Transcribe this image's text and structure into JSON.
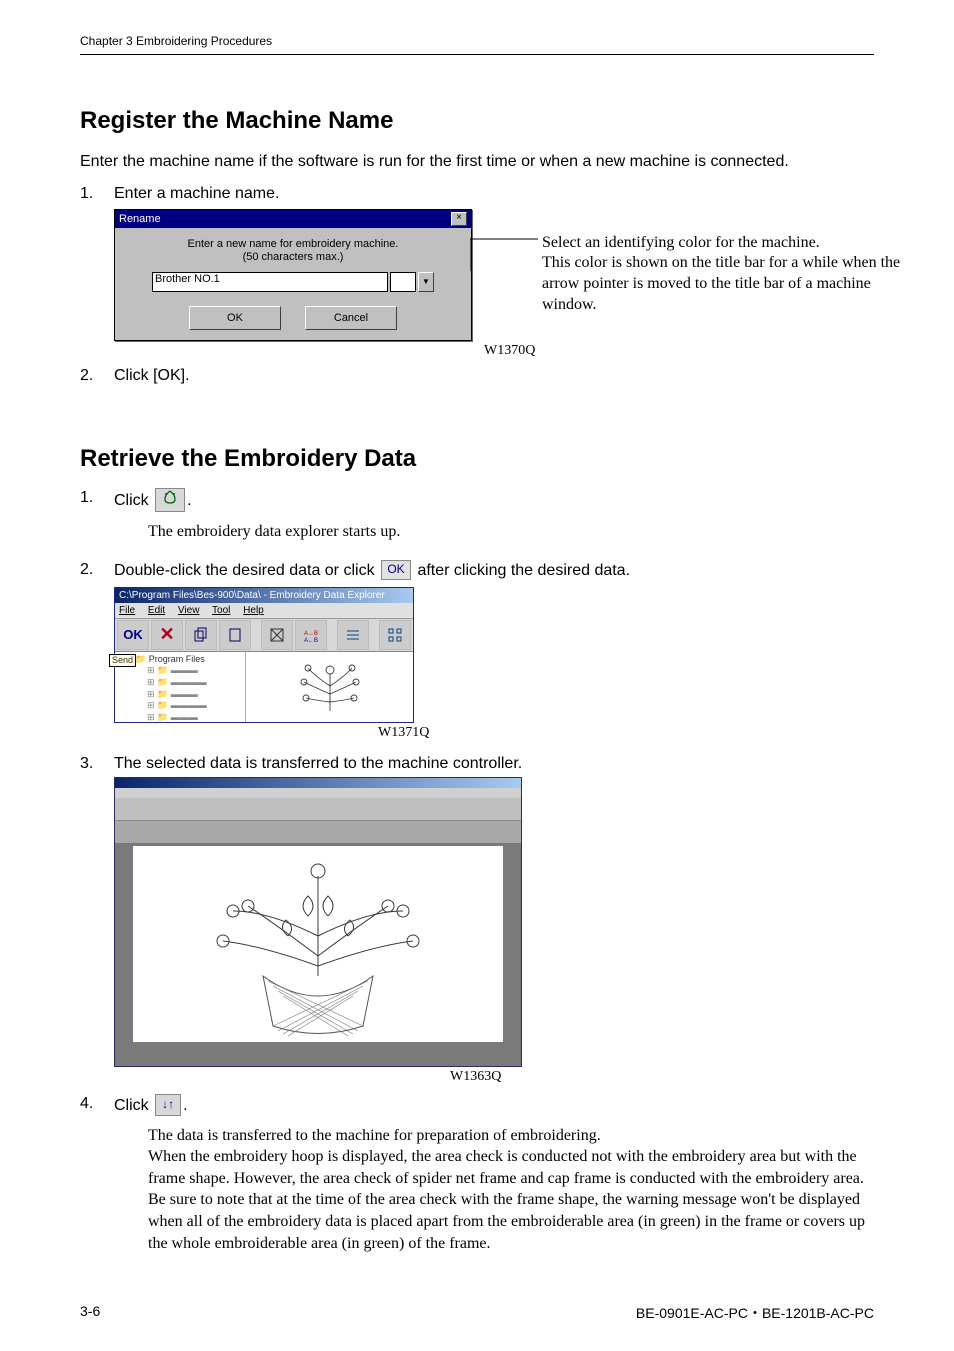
{
  "running_head": "Chapter 3 Embroidering Procedures",
  "section1": {
    "title": "Register the Machine Name",
    "intro": "Enter the machine name if the software is run for the first time or when a new machine is connected.",
    "step1": "Enter a machine name.",
    "step2": "Click [OK].",
    "step1_num": "1.",
    "step2_num": "2.",
    "dialog": {
      "title": "Rename",
      "close": "×",
      "prompt_l1": "Enter a new name for embroidery machine.",
      "prompt_l2": "(50 characters max.)",
      "input_value": "Brother NO.1",
      "ok": "OK",
      "cancel": "Cancel",
      "arrow": "▼"
    },
    "annotation": "Select an identifying color for the machine.\nThis color is shown on the title bar for a while when the arrow pointer is moved to the title bar of a machine window.",
    "fig_code": "W1370Q"
  },
  "section2": {
    "title": "Retrieve the Embroidery Data",
    "step1_num": "1.",
    "step1_a": "Click ",
    "step1_b": ".",
    "step1_note": "The embroidery data explorer starts up.",
    "step2_num": "2.",
    "step2_a": "Double-click the desired data or click  ",
    "step2_ok": "OK",
    "step2_b": " after clicking the desired data.",
    "explorer": {
      "title": "C:\\Program Files\\Bes-900\\Data\\ - Embroidery Data Explorer",
      "menu_file": "File",
      "menu_edit": "Edit",
      "menu_view": "View",
      "menu_tool": "Tool",
      "menu_help": "Help",
      "ok": "OK",
      "x": "✕",
      "send": "Send",
      "folder": "Program Files"
    },
    "fig2_code": "W1371Q",
    "step3_num": "3.",
    "step3": "The selected data is transferred to the machine controller.",
    "fig3_code": "W1363Q",
    "step4_num": "4.",
    "step4_a": "Click ",
    "step4_icon": "↓↑",
    "step4_b": ".",
    "step4_note": "The data is transferred to the machine for preparation of embroidering.\nWhen the embroidery hoop is displayed, the area check is conducted not with the embroidery area but with the frame shape. However, the area check of spider net frame and cap frame is conducted with the embroidery area.\nBe sure to note that at the time of the area check with the frame shape, the warning message won't be displayed when all of the embroidery data is placed apart from the embroiderable area (in green) in the frame or covers up the whole embroiderable area (in green) of the frame."
  },
  "footer": {
    "left": "3-6",
    "right": "BE-0901E-AC-PC・BE-1201B-AC-PC"
  }
}
